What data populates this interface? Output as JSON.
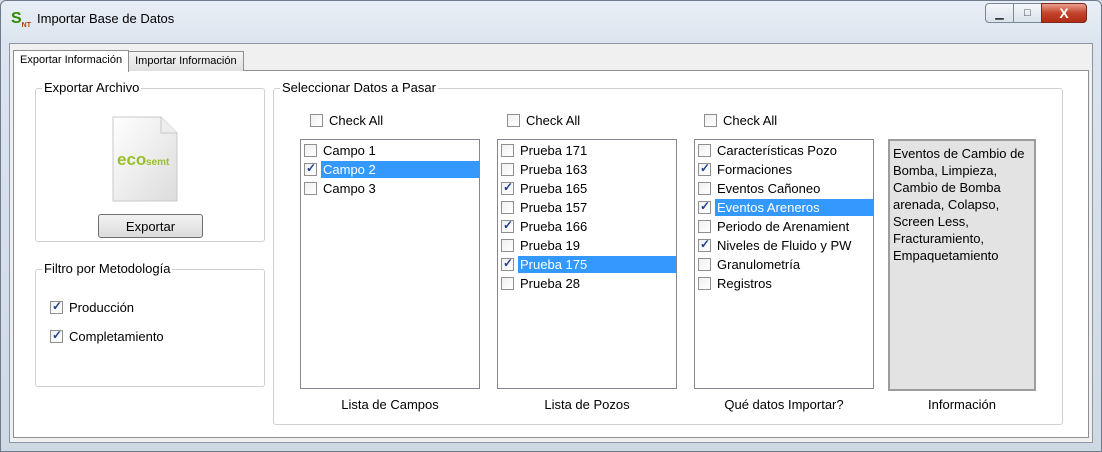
{
  "window": {
    "title": "Importar Base de Datos",
    "logo_text": "S",
    "logo_sub": "NT",
    "controls": {
      "minimize": "▁",
      "maximize": "□",
      "close": "X"
    }
  },
  "tabs": [
    {
      "label": "Exportar Información",
      "active": true
    },
    {
      "label": "Importar Información",
      "active": false
    }
  ],
  "export": {
    "group_title": "Exportar Archivo",
    "doc_label_eco": "eco",
    "doc_label_semt": "semt",
    "button_label": "Exportar"
  },
  "filter": {
    "group_title": "Filtro por Metodología",
    "options": [
      {
        "label": "Producción",
        "checked": true
      },
      {
        "label": "Completamiento",
        "checked": true
      }
    ]
  },
  "select": {
    "group_title": "Seleccionar Datos a Pasar",
    "check_all_label": "Check All",
    "lists": [
      {
        "caption": "Lista de Campos",
        "items": [
          {
            "label": "Campo 1",
            "checked": false,
            "selected": false
          },
          {
            "label": "Campo 2",
            "checked": true,
            "selected": true
          },
          {
            "label": "Campo 3",
            "checked": false,
            "selected": false
          }
        ]
      },
      {
        "caption": "Lista de Pozos",
        "items": [
          {
            "label": "Prueba 171",
            "checked": false,
            "selected": false
          },
          {
            "label": "Prueba 163",
            "checked": false,
            "selected": false
          },
          {
            "label": "Prueba 165",
            "checked": true,
            "selected": false
          },
          {
            "label": "Prueba 157",
            "checked": false,
            "selected": false
          },
          {
            "label": "Prueba 166",
            "checked": true,
            "selected": false
          },
          {
            "label": "Prueba 19",
            "checked": false,
            "selected": false
          },
          {
            "label": "Prueba 175",
            "checked": true,
            "selected": true
          },
          {
            "label": "Prueba 28",
            "checked": false,
            "selected": false
          }
        ]
      },
      {
        "caption": "Qué datos Importar?",
        "items": [
          {
            "label": "Características Pozo",
            "checked": false,
            "selected": false
          },
          {
            "label": "Formaciones",
            "checked": true,
            "selected": false
          },
          {
            "label": "Eventos Cañoneo",
            "checked": false,
            "selected": false
          },
          {
            "label": "Eventos Areneros",
            "checked": true,
            "selected": true
          },
          {
            "label": "Periodo de Arenamient",
            "checked": false,
            "selected": false
          },
          {
            "label": "Niveles de Fluido y PW",
            "checked": true,
            "selected": false
          },
          {
            "label": "Granulometría",
            "checked": false,
            "selected": false
          },
          {
            "label": "Registros",
            "checked": false,
            "selected": false
          }
        ]
      }
    ],
    "info_caption": "Información",
    "info_text": "Eventos de Cambio de Bomba, Limpieza, Cambio de Bomba arenada, Colapso, Screen Less, Fracturamiento, Empaquetamiento"
  }
}
